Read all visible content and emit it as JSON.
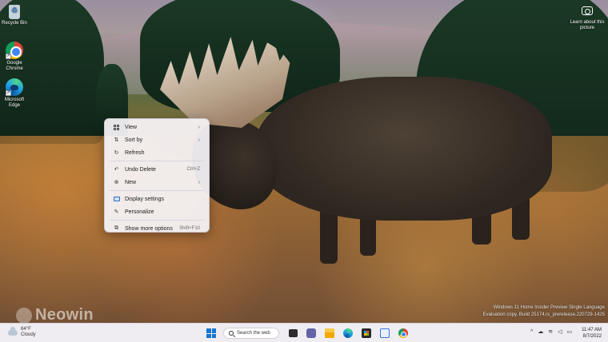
{
  "desktop": {
    "icons": [
      {
        "label": "Recycle Bin"
      },
      {
        "label": "Google Chrome"
      },
      {
        "label": "Microsoft Edge"
      }
    ],
    "learn_label": "Learn about this picture",
    "watermark": "Neowin",
    "eval_text": [
      "Windows 11 Home Insider Preview Single Language",
      "Evaluation copy. Build 25174.rs_prerelease.220729-1425"
    ]
  },
  "context_menu": {
    "items": [
      {
        "label": "View",
        "shortcut": "",
        "has_submenu": true,
        "icon": "view-icon"
      },
      {
        "label": "Sort by",
        "shortcut": "",
        "has_submenu": true,
        "icon": "sort-icon"
      },
      {
        "label": "Refresh",
        "shortcut": "",
        "has_submenu": false,
        "icon": "refresh-icon"
      },
      {
        "label": "Undo Delete",
        "shortcut": "Ctrl+Z",
        "has_submenu": false,
        "icon": "undo-icon"
      },
      {
        "label": "New",
        "shortcut": "",
        "has_submenu": true,
        "icon": "new-icon"
      },
      {
        "label": "Display settings",
        "shortcut": "",
        "has_submenu": false,
        "icon": "display-icon"
      },
      {
        "label": "Personalize",
        "shortcut": "",
        "has_submenu": false,
        "icon": "personalize-icon"
      },
      {
        "label": "Show more options",
        "shortcut": "Shift+F10",
        "has_submenu": false,
        "icon": "more-options-icon"
      }
    ],
    "submenu_arrow": "›"
  },
  "taskbar": {
    "weather": {
      "temp": "84°F",
      "condition": "Cloudy"
    },
    "search_label": "Search the web",
    "apps": [
      "task-view",
      "teams",
      "file-explorer",
      "edge",
      "store",
      "snipping-tool",
      "chrome"
    ],
    "tray_glyphs": {
      "chevron": "^",
      "cloud": "☁",
      "wifi": "≋",
      "volume": "◁",
      "battery": "▭"
    },
    "time": "11:47 AM",
    "date": "8/7/2022"
  },
  "colors": {
    "accent": "#1976d2",
    "menu_bg": "#f6f4f8",
    "taskbar_bg": "#eeecf0"
  }
}
